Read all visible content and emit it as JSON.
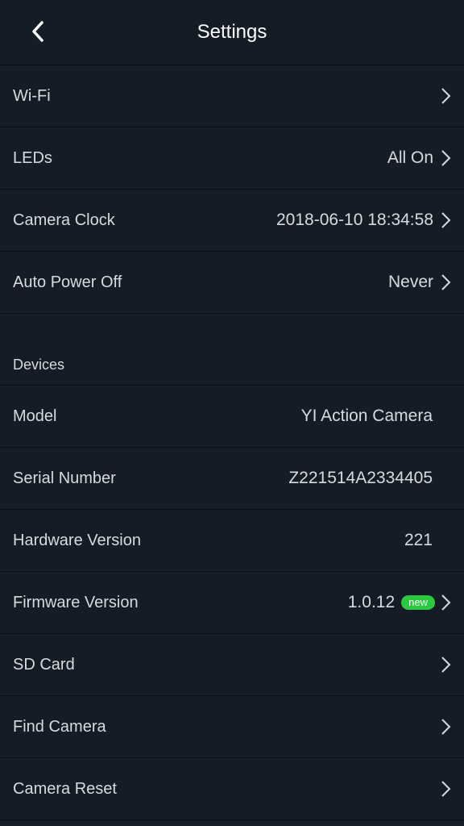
{
  "header": {
    "title": "Settings"
  },
  "rows": {
    "wifi": {
      "label": "Wi-Fi"
    },
    "leds": {
      "label": "LEDs",
      "value": "All On"
    },
    "clock": {
      "label": "Camera Clock",
      "value": "2018-06-10 18:34:58"
    },
    "power": {
      "label": "Auto Power Off",
      "value": "Never"
    }
  },
  "devices": {
    "section_title": "Devices",
    "model": {
      "label": "Model",
      "value": "YI Action Camera"
    },
    "serial": {
      "label": "Serial Number",
      "value": "Z221514A2334405"
    },
    "hardware": {
      "label": "Hardware Version",
      "value": "221"
    },
    "firmware": {
      "label": "Firmware Version",
      "value": "1.0.12",
      "badge": "new"
    },
    "sd": {
      "label": "SD Card"
    },
    "find": {
      "label": "Find Camera"
    },
    "reset": {
      "label": "Camera Reset"
    }
  },
  "colors": {
    "background": "#141d26",
    "badge": "#2bc93f",
    "divider": "#0a0f14"
  }
}
